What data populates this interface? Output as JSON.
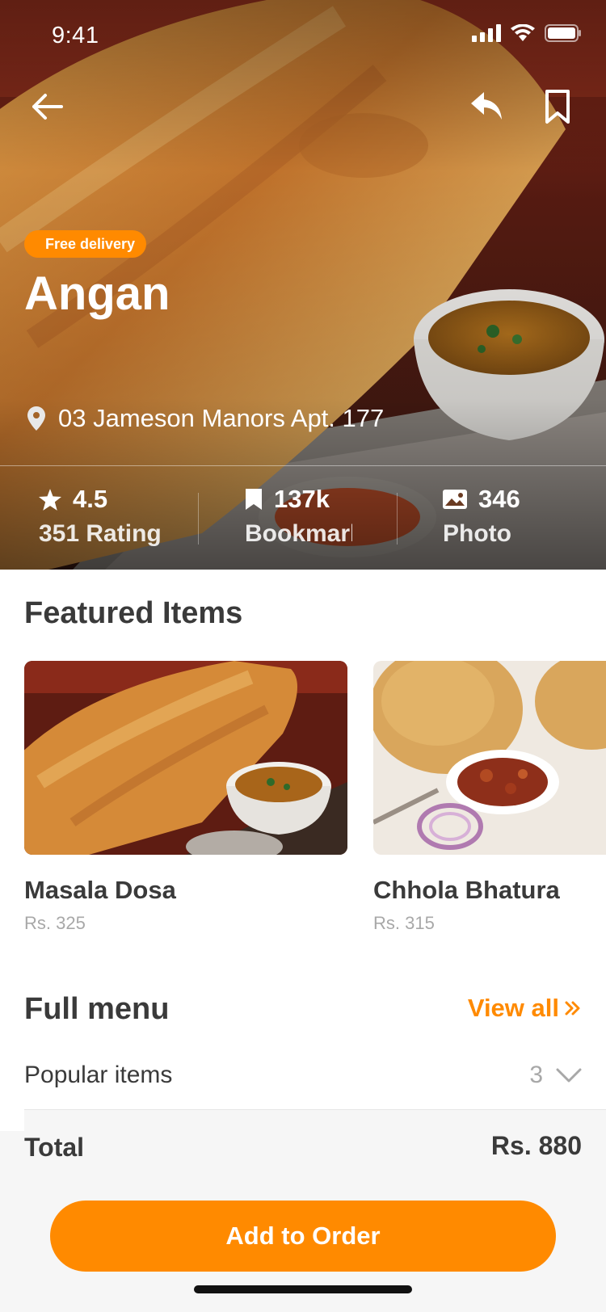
{
  "status_bar": {
    "time": "9:41"
  },
  "hero": {
    "badge": "Free delivery",
    "name": "Angan",
    "address": "03 Jameson Manors Apt. 177",
    "stats": [
      {
        "icon": "star-icon",
        "value": "4.5",
        "label": "351 Rating"
      },
      {
        "icon": "bookmark-icon",
        "value": "137k",
        "label": "Bookmark"
      },
      {
        "icon": "photo-icon",
        "value": "346",
        "label": "Photo"
      }
    ]
  },
  "featured": {
    "title": "Featured Items",
    "items": [
      {
        "name": "Masala Dosa",
        "price": "Rs. 325"
      },
      {
        "name": "Chhola Bhatura",
        "price": "Rs. 315"
      }
    ]
  },
  "full_menu": {
    "title": "Full menu",
    "view_all": "View all",
    "rows": [
      {
        "label": "Popular items",
        "count": "3"
      }
    ]
  },
  "order": {
    "total_label": "Total",
    "total_value": "Rs. 880",
    "cta": "Add to Order"
  },
  "colors": {
    "accent": "#ff8a00",
    "text_dark": "#3a3a3a",
    "text_muted": "#a8a8a8",
    "sheet_bg": "#f6f6f6"
  }
}
